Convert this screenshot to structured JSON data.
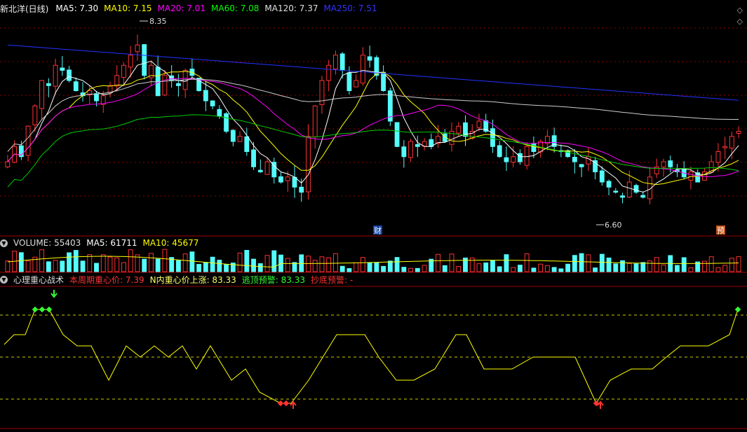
{
  "main_panel": {
    "title": "新北洋(日线)",
    "indicators": [
      {
        "label": "MA5: 7.30",
        "color": "#ffffff"
      },
      {
        "label": "MA10: 7.15",
        "color": "#ffff00"
      },
      {
        "label": "MA20: 7.01",
        "color": "#ff00ff"
      },
      {
        "label": "MA60: 7.08",
        "color": "#00ff00"
      },
      {
        "label": "MA120: 7.37",
        "color": "#e0e0e0"
      },
      {
        "label": "MA250: 7.51",
        "color": "#3333ff"
      }
    ],
    "high_label": "8.35",
    "low_label": "6.60",
    "marker_cai": "财",
    "marker_yu": "预"
  },
  "volume_panel": {
    "label": "VOLUME: 55403",
    "ma5": "MA5: 61711",
    "ma10": "MA10: 45677"
  },
  "indicator_panel": {
    "name": "心理重心战术",
    "items": [
      {
        "label": "本周期重心价: 7.39",
        "color": "#ff3333"
      },
      {
        "label": "N内重心价上涨: 83.33",
        "color": "#ffff66"
      },
      {
        "label": "逃顶预警: 83.33",
        "color": "#33ff33"
      },
      {
        "label": "抄底预警: -",
        "color": "#ff3333"
      }
    ]
  },
  "colors": {
    "up": "#ff3232",
    "down": "#54fcfc",
    "grid": "#8b0000",
    "line_yellow": "#ffff00",
    "dashed_yellow": "#cccc00"
  },
  "chart_data": {
    "type": "line",
    "price_range": [
      6.6,
      8.35
    ],
    "closes": [
      7.05,
      7.2,
      7.1,
      7.4,
      7.6,
      7.85,
      7.8,
      8.0,
      7.95,
      7.85,
      7.75,
      7.7,
      7.75,
      7.65,
      7.7,
      7.8,
      7.9,
      8.0,
      8.1,
      8.2,
      7.9,
      8.0,
      7.7,
      7.9,
      7.85,
      7.8,
      7.95,
      7.9,
      7.75,
      7.65,
      7.6,
      7.5,
      7.35,
      7.25,
      7.3,
      7.15,
      7.0,
      6.95,
      7.05,
      6.9,
      6.85,
      6.9,
      6.8,
      6.75,
      7.3,
      7.6,
      7.85,
      8.0,
      8.1,
      7.95,
      7.75,
      7.85,
      8.1,
      8.05,
      7.9,
      7.75,
      7.45,
      7.2,
      7.1,
      7.25,
      7.2,
      7.25,
      7.2,
      7.3,
      7.25,
      7.35,
      7.4,
      7.3,
      7.35,
      7.45,
      7.35,
      7.2,
      7.1,
      7.05,
      7.1,
      7.05,
      7.2,
      7.15,
      7.25,
      7.3,
      7.2,
      7.15,
      7.1,
      7.05,
      7.0,
      7.1,
      6.95,
      6.85,
      6.8,
      6.75,
      6.7,
      6.85,
      6.75,
      6.7,
      6.9,
      7.0,
      7.05,
      7.0,
      6.95,
      6.9,
      6.95,
      6.85,
      6.95,
      7.05,
      7.15,
      7.2,
      7.3,
      7.35
    ]
  }
}
